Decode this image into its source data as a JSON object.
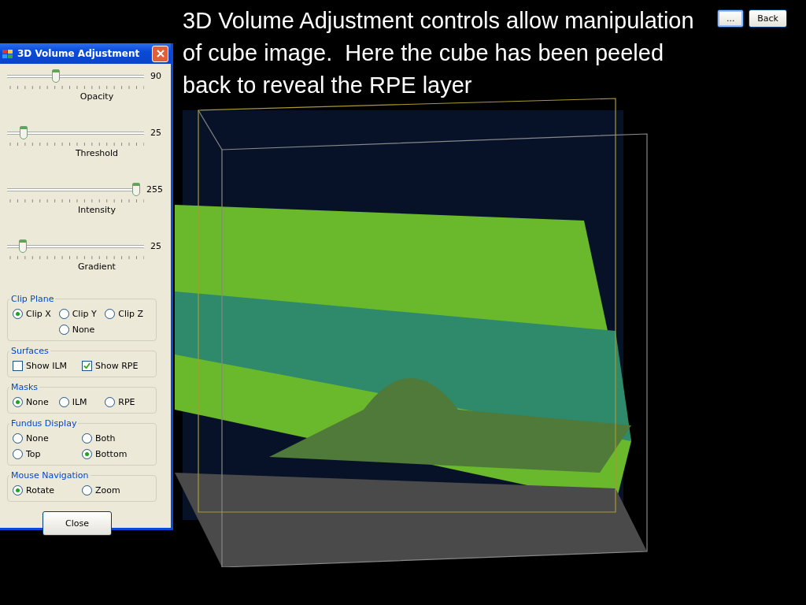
{
  "caption": "3D Volume Adjustment controls allow manipulation of cube image.  Here the cube has been peeled back to reveal the RPE layer",
  "top_buttons": [
    "...",
    "Back"
  ],
  "dialog": {
    "title": "3D Volume Adjustment",
    "sliders": [
      {
        "label": "Opacity",
        "reading": "90",
        "level": 0.35
      },
      {
        "label": "Threshold",
        "reading": "25",
        "level": 0.1
      },
      {
        "label": "Intensity",
        "reading": "255",
        "level": 1
      },
      {
        "label": "Gradient",
        "reading": "25",
        "level": 0.09
      }
    ],
    "groups": [
      {
        "title": "Clip Plane",
        "kind": "radio",
        "rows": [
          [
            {
              "label": "Clip X",
              "selected": true
            },
            {
              "label": "Clip Y",
              "selected": false
            },
            {
              "label": "Clip Z",
              "selected": false
            }
          ],
          [
            "",
            {
              "label": "None",
              "selected": false
            }
          ]
        ]
      },
      {
        "title": "Surfaces",
        "kind": "checkbox",
        "rows": [
          [
            {
              "label": "Show ILM",
              "checked": false
            },
            {
              "label": "Show RPE",
              "checked": true
            }
          ]
        ]
      },
      {
        "title": "Masks",
        "kind": "radio",
        "rows": [
          [
            {
              "label": "None",
              "selected": true
            },
            {
              "label": "ILM",
              "selected": false
            },
            {
              "label": "RPE",
              "selected": false
            }
          ]
        ]
      },
      {
        "title": "Fundus Display",
        "kind": "radio",
        "rows": [
          [
            {
              "label": "None",
              "selected": false
            },
            {
              "label": "Both",
              "selected": false
            }
          ],
          [
            {
              "label": "Top",
              "selected": false
            },
            {
              "label": "Bottom",
              "selected": true
            }
          ]
        ]
      },
      {
        "title": "Mouse Navigation",
        "kind": "radio",
        "rows": [
          [
            {
              "label": "Rotate",
              "selected": true
            },
            {
              "label": "Zoom",
              "selected": false
            }
          ]
        ]
      }
    ],
    "close_button": "Close"
  }
}
